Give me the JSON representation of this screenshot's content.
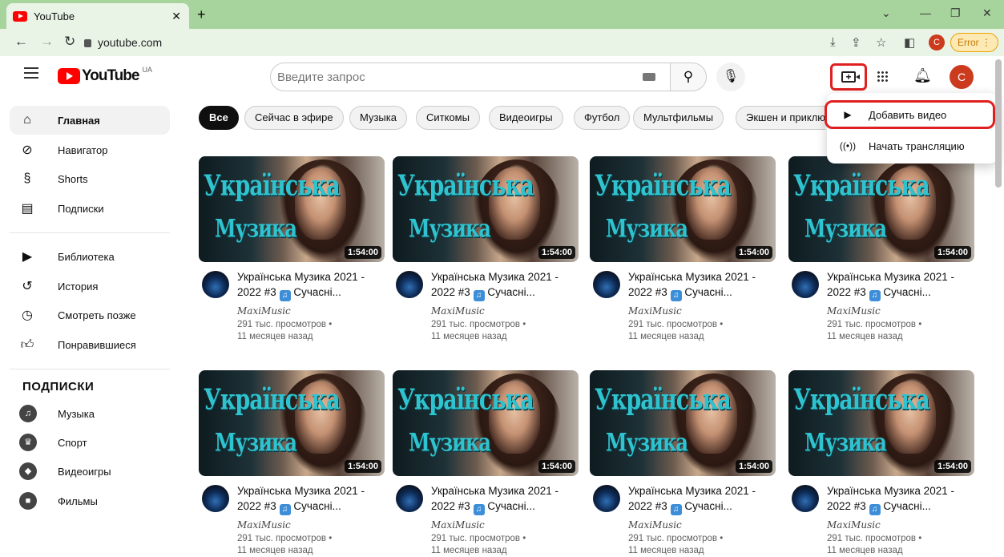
{
  "browser": {
    "tab_title": "YouTube",
    "url": "youtube.com",
    "error_label": "Error",
    "avatar_letter": "C"
  },
  "header": {
    "logo_word": "YouTube",
    "country": "UA",
    "search_placeholder": "Введите запрос",
    "avatar_letter": "C"
  },
  "sidebar": {
    "items": [
      {
        "label": "Главная",
        "icon": "home-icon"
      },
      {
        "label": "Навигатор",
        "icon": "compass-icon"
      },
      {
        "label": "Shorts",
        "icon": "shorts-icon"
      },
      {
        "label": "Подписки",
        "icon": "subscriptions-icon"
      }
    ],
    "library": [
      {
        "label": "Библиотека",
        "icon": "library-icon"
      },
      {
        "label": "История",
        "icon": "history-icon"
      },
      {
        "label": "Смотреть позже",
        "icon": "clock-icon"
      },
      {
        "label": "Понравившиеся",
        "icon": "like-icon"
      }
    ],
    "subs_heading": "ПОДПИСКИ",
    "subs": [
      {
        "label": "Музыка"
      },
      {
        "label": "Спорт"
      },
      {
        "label": "Видеоигры"
      },
      {
        "label": "Фильмы"
      }
    ]
  },
  "chips": [
    "Все",
    "Сейчас в эфире",
    "Музыка",
    "Ситкомы",
    "Видеоигры",
    "Футбол",
    "Мультфильмы",
    "Экшен и приключения"
  ],
  "create_menu": {
    "items": [
      {
        "label": "Добавить видео",
        "icon": "upload-video-icon"
      },
      {
        "label": "Начать трансляцию",
        "icon": "live-icon"
      }
    ]
  },
  "video": {
    "thumb_line1": "Українська",
    "thumb_line2": "Музика",
    "duration": "1:54:00",
    "title_a": "Українська Музика 2021 -",
    "title_b": "2022 #3",
    "title_c": "Сучасні...",
    "channel": "MaxiMusic",
    "views": "291 тыс. просмотров •",
    "age": "11 месяцев назад"
  },
  "accent": {
    "red": "#ff0000",
    "highlight": "#e02020"
  }
}
